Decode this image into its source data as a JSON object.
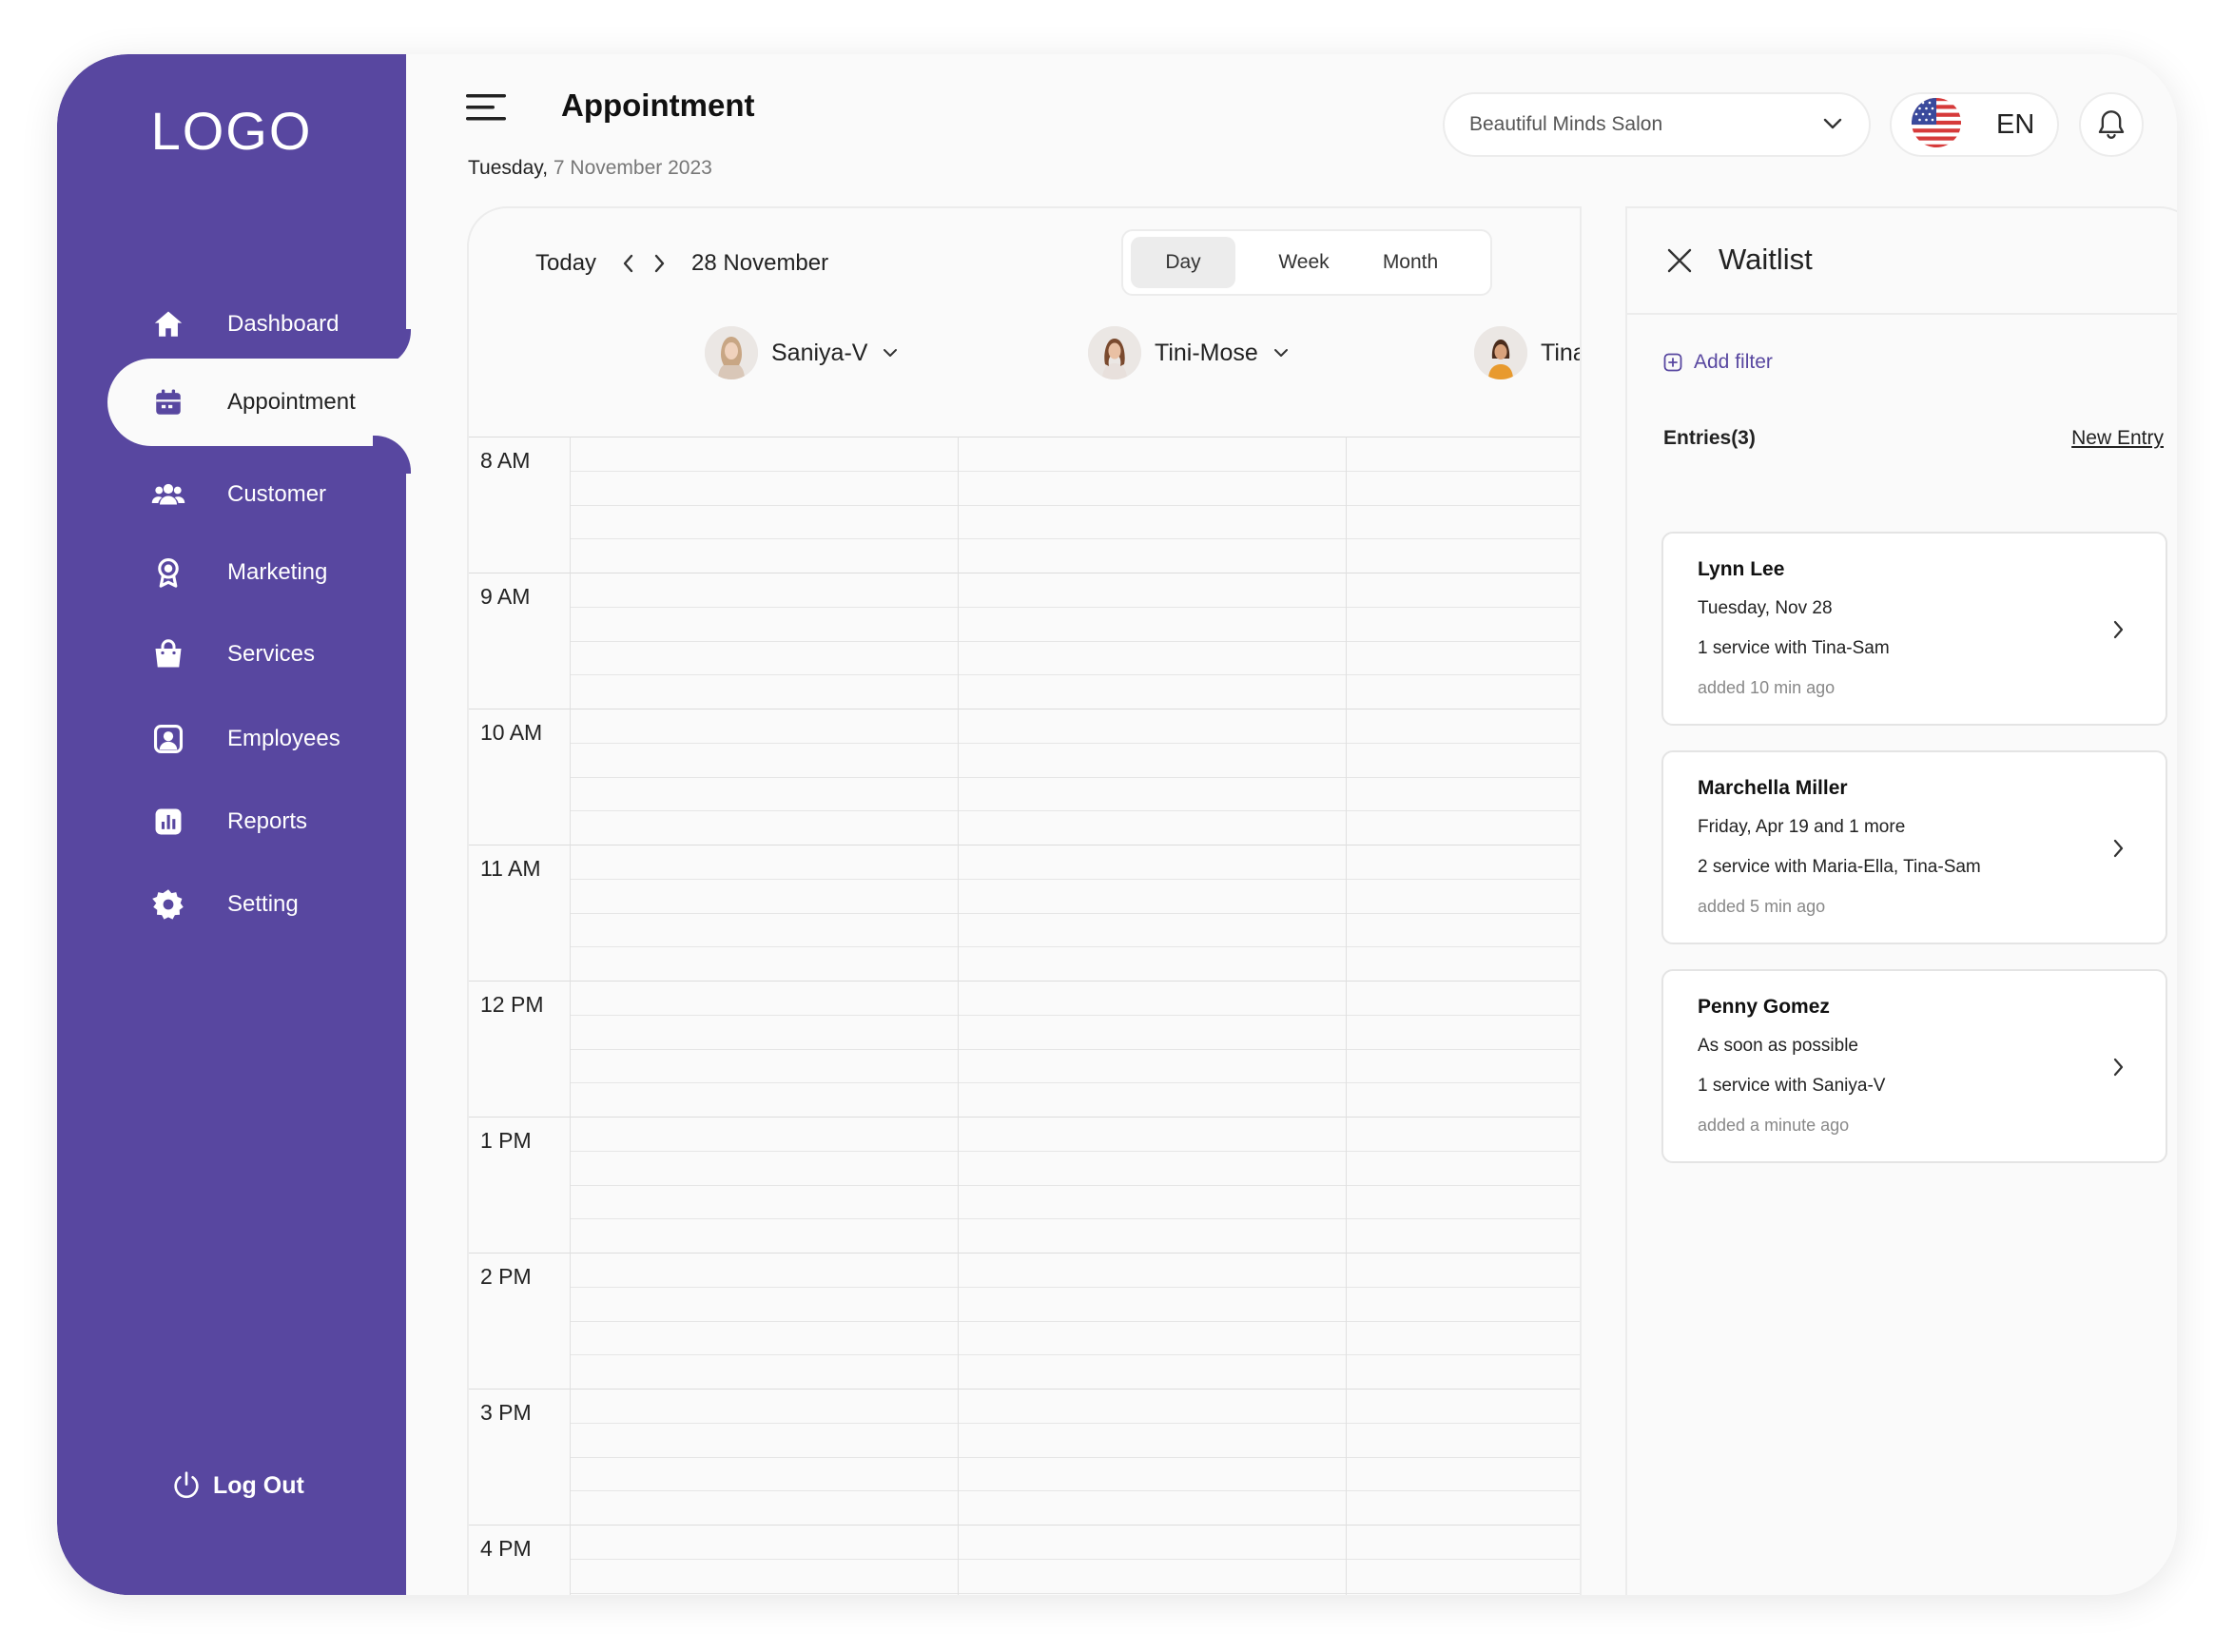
{
  "sidebar": {
    "logo": "LOGO",
    "items": [
      {
        "label": "Dashboard",
        "icon": "home-icon"
      },
      {
        "label": "Appointment",
        "icon": "calendar-icon",
        "active": true
      },
      {
        "label": "Customer",
        "icon": "users-icon"
      },
      {
        "label": "Marketing",
        "icon": "award-icon"
      },
      {
        "label": "Services",
        "icon": "shopping-bag-icon"
      },
      {
        "label": "Employees",
        "icon": "user-card-icon"
      },
      {
        "label": "Reports",
        "icon": "bar-chart-icon"
      },
      {
        "label": "Setting",
        "icon": "gear-icon"
      }
    ],
    "logout": "Log Out"
  },
  "header": {
    "title": "Appointment",
    "weekday": "Tuesday,",
    "date": "7 November 2023",
    "salon": "Beautiful Minds Salon",
    "language": "EN"
  },
  "calendar": {
    "today": "Today",
    "current_date": "28 November",
    "views": [
      "Day",
      "Week",
      "Month"
    ],
    "active_view": "Day",
    "staff": [
      "Saniya-V",
      "Tini-Mose",
      "Tina-sam"
    ],
    "hours": [
      "8  AM",
      "9  AM",
      "10  AM",
      "11  AM",
      "12  PM",
      "1  PM",
      "2  PM",
      "3  PM",
      "4  PM"
    ]
  },
  "waitlist": {
    "title": "Waitlist",
    "add_filter": "Add filter",
    "entries_label": "Entries(3)",
    "new_entry": "New Entry",
    "entries": [
      {
        "name": "Lynn Lee",
        "when": "Tuesday, Nov 28",
        "service": "1 service with Tina-Sam",
        "added": "added 10 min ago"
      },
      {
        "name": "Marchella Miller",
        "when": "Friday, Apr 19 and 1 more",
        "service": "2 service with Maria-Ella, Tina-Sam",
        "added": "added 5 min ago"
      },
      {
        "name": "Penny Gomez",
        "when": "As soon as possible",
        "service": "1 service with Saniya-V",
        "added": "added a minute ago"
      }
    ]
  },
  "colors": {
    "brand": "#5847a0",
    "background": "#fafafa"
  }
}
